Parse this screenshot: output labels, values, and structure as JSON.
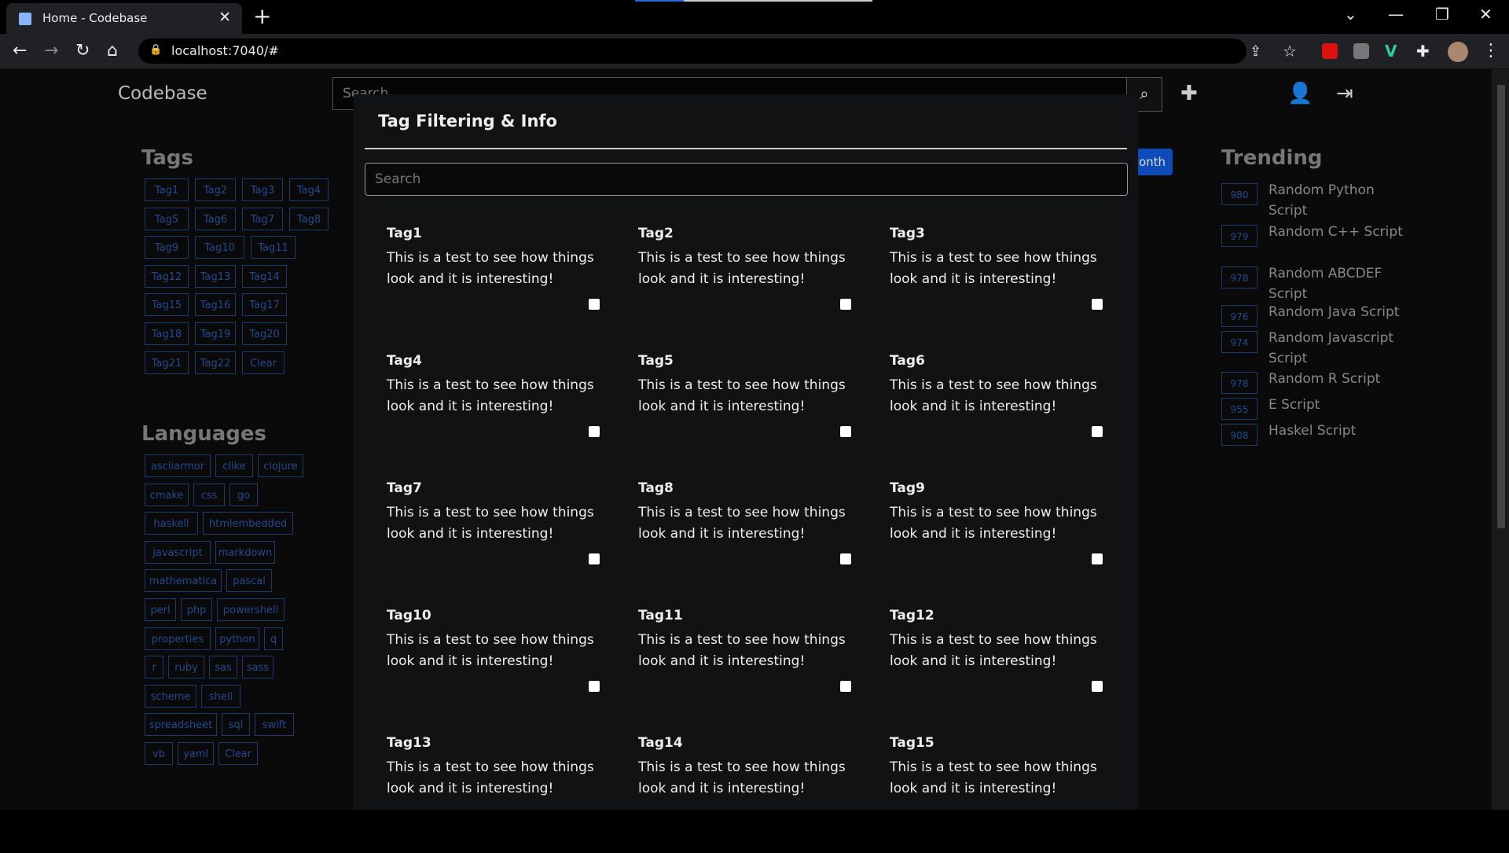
{
  "browser": {
    "tab_title": "Home - Codebase",
    "url": "localhost:7040/#"
  },
  "header": {
    "brand": "Codebase",
    "search_placeholder": "Search",
    "month_label": "onth"
  },
  "sidebar": {
    "tags_title": "Tags",
    "tags": [
      "Tag1",
      "Tag2",
      "Tag3",
      "Tag4",
      "Tag5",
      "Tag6",
      "Tag7",
      "Tag8",
      "Tag9",
      "Tag10",
      "Tag11",
      "Tag12",
      "Tag13",
      "Tag14",
      "Tag15",
      "Tag16",
      "Tag17",
      "Tag18",
      "Tag19",
      "Tag20",
      "Tag21",
      "Tag22",
      "Clear"
    ],
    "languages_title": "Languages",
    "languages": [
      "asciiarmor",
      "clike",
      "clojure",
      "cmake",
      "css",
      "go",
      "haskell",
      "htmlembedded",
      "javascript",
      "markdown",
      "mathematica",
      "pascal",
      "perl",
      "php",
      "powershell",
      "properties",
      "python",
      "q",
      "r",
      "ruby",
      "sas",
      "sass",
      "scheme",
      "shell",
      "spreadsheet",
      "sql",
      "swift",
      "vb",
      "yaml",
      "Clear"
    ]
  },
  "trending": {
    "title": "Trending",
    "items": [
      {
        "count": "980",
        "label": "Random Python Script"
      },
      {
        "count": "979",
        "label": "Random C++ Script"
      },
      {
        "count": "978",
        "label": "Random ABCDEF Script"
      },
      {
        "count": "976",
        "label": "Random Java Script"
      },
      {
        "count": "974",
        "label": "Random Javascript Script"
      },
      {
        "count": "978",
        "label": "Random R Script"
      },
      {
        "count": "955",
        "label": "E Script"
      },
      {
        "count": "908",
        "label": "Haskel Script"
      }
    ]
  },
  "modal": {
    "title": "Tag Filtering & Info",
    "search_placeholder": "Search",
    "tags": [
      {
        "name": "Tag1",
        "desc": "This is a test to see how things look and it is interesting!"
      },
      {
        "name": "Tag2",
        "desc": "This is a test to see how things look and it is interesting!"
      },
      {
        "name": "Tag3",
        "desc": "This is a test to see how things look and it is interesting!"
      },
      {
        "name": "Tag4",
        "desc": "This is a test to see how things look and it is interesting!"
      },
      {
        "name": "Tag5",
        "desc": "This is a test to see how things look and it is interesting!"
      },
      {
        "name": "Tag6",
        "desc": "This is a test to see how things look and it is interesting!"
      },
      {
        "name": "Tag7",
        "desc": "This is a test to see how things look and it is interesting!"
      },
      {
        "name": "Tag8",
        "desc": "This is a test to see how things look and it is interesting!"
      },
      {
        "name": "Tag9",
        "desc": "This is a test to see how things look and it is interesting!"
      },
      {
        "name": "Tag10",
        "desc": "This is a test to see how things look and it is interesting!"
      },
      {
        "name": "Tag11",
        "desc": "This is a test to see how things look and it is interesting!"
      },
      {
        "name": "Tag12",
        "desc": "This is a test to see how things look and it is interesting!"
      },
      {
        "name": "Tag13",
        "desc": "This is a test to see how things look and it is interesting!"
      },
      {
        "name": "Tag14",
        "desc": "This is a test to see how things look and it is interesting!"
      },
      {
        "name": "Tag15",
        "desc": "This is a test to see how things look and it is interesting!"
      }
    ]
  }
}
